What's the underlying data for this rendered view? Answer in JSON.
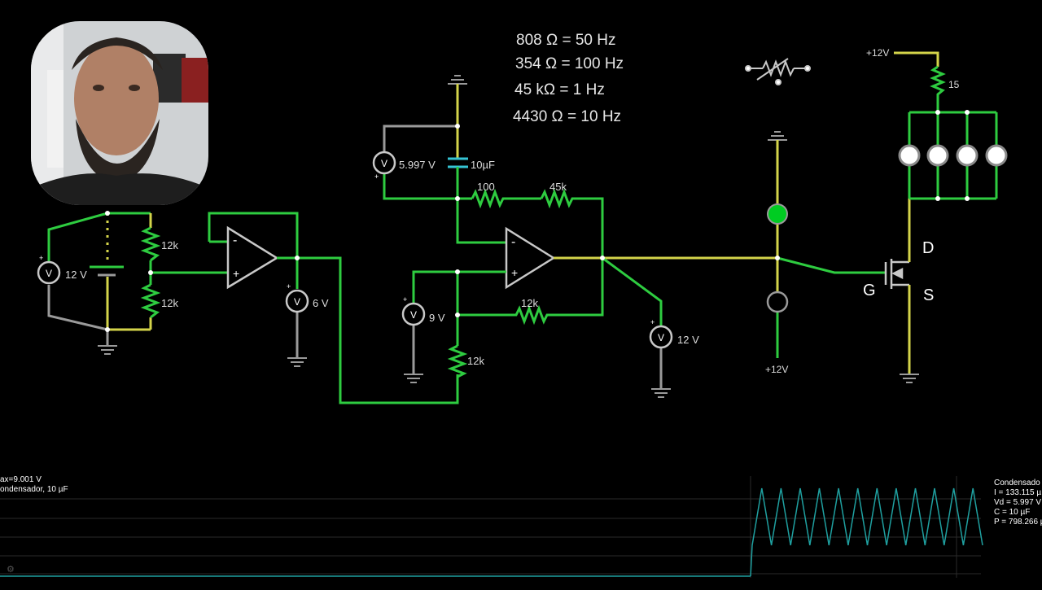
{
  "notes": {
    "line1": "808 Ω = 50 Hz",
    "line2": "354 Ω = 100 Hz",
    "line3": "45 kΩ = 1 Hz",
    "line4": "4430 Ω = 10 Hz"
  },
  "labels": {
    "r_top_left": "12k",
    "r_bottom_left": "12k",
    "v_source_left": "12 V",
    "v_mid_6": "6 V",
    "v_cap": "5.997 V",
    "cap_value": "10µF",
    "r_100": "100",
    "r_45k": "45k",
    "r_12k_feedback": "12k",
    "r_12k_bottom": "12k",
    "v_9": "9 V",
    "v_12_right": "12 V",
    "supply_top": "+12V",
    "supply_bottom": "+12V",
    "r_15": "15",
    "mosfet_d": "D",
    "mosfet_g": "G",
    "mosfet_s": "S",
    "opamp_minus": "-",
    "opamp_plus": "+",
    "voltmeter_glyph": "V"
  },
  "scope": {
    "left_line1": "ax=9.001 V",
    "left_line2": "ondensador, 10 µF",
    "info_title": "Condensado",
    "info_i": "I = 133.115 µ",
    "info_vd": "Vd = 5.997 V",
    "info_c": "C = 10 µF",
    "info_p": "P = 798.266 µ",
    "waveform_color": "#1fa0a0",
    "cycles": 12
  },
  "colors": {
    "wire_green": "#2ecc40",
    "wire_yellow": "#d4d44a",
    "wire_gray": "#9a9a9a",
    "led_on": "#00cc22",
    "background": "#000000"
  }
}
